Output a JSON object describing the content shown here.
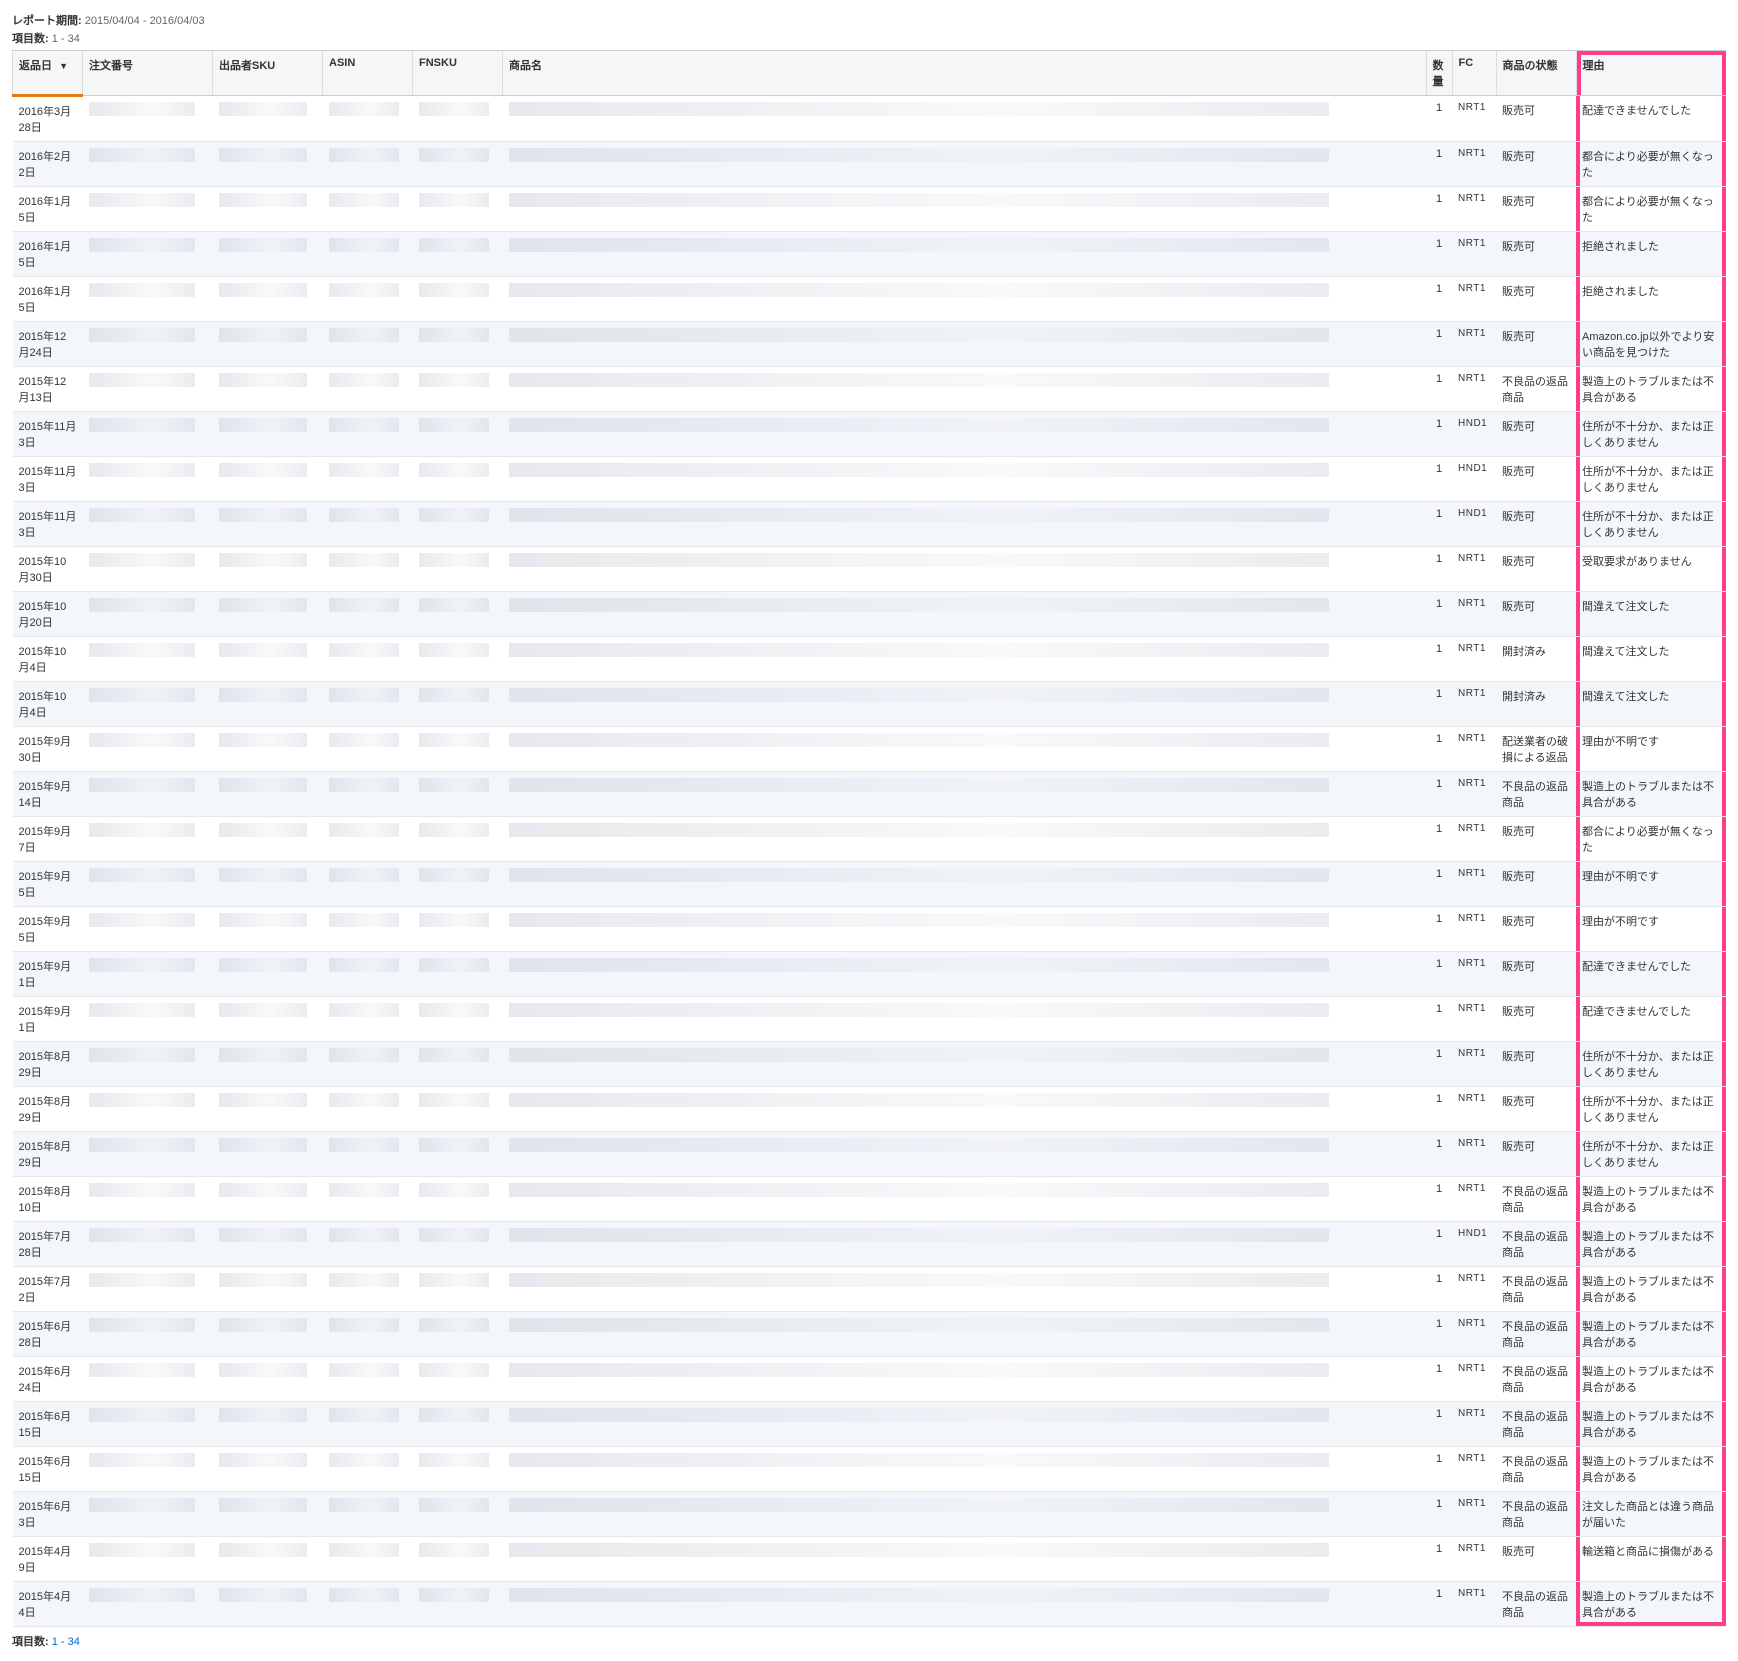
{
  "header": {
    "report_period_label": "レポート期間:",
    "report_period_value": "2015/04/04 - 2016/04/03",
    "count_label": "項目数:",
    "count_value": "1 - 34"
  },
  "columns": {
    "return_date": "返品日",
    "order_id": "注文番号",
    "seller_sku": "出品者SKU",
    "asin": "ASIN",
    "fnsku": "FNSKU",
    "product_name": "商品名",
    "quantity": "数量",
    "fc": "FC",
    "condition": "商品の状態",
    "reason": "理由"
  },
  "rows": [
    {
      "date": "2016年3月28日",
      "qty": "1",
      "fc": "NRT1",
      "cond": "販売可",
      "reason": "配達できませんでした"
    },
    {
      "date": "2016年2月2日",
      "qty": "1",
      "fc": "NRT1",
      "cond": "販売可",
      "reason": "都合により必要が無くなった"
    },
    {
      "date": "2016年1月5日",
      "qty": "1",
      "fc": "NRT1",
      "cond": "販売可",
      "reason": "都合により必要が無くなった"
    },
    {
      "date": "2016年1月5日",
      "qty": "1",
      "fc": "NRT1",
      "cond": "販売可",
      "reason": "拒絶されました"
    },
    {
      "date": "2016年1月5日",
      "qty": "1",
      "fc": "NRT1",
      "cond": "販売可",
      "reason": "拒絶されました"
    },
    {
      "date": "2015年12月24日",
      "qty": "1",
      "fc": "NRT1",
      "cond": "販売可",
      "reason": "Amazon.co.jp以外でより安い商品を見つけた"
    },
    {
      "date": "2015年12月13日",
      "qty": "1",
      "fc": "NRT1",
      "cond": "不良品の返品商品",
      "reason": "製造上のトラブルまたは不具合がある"
    },
    {
      "date": "2015年11月3日",
      "qty": "1",
      "fc": "HND1",
      "cond": "販売可",
      "reason": "住所が不十分か、または正しくありません"
    },
    {
      "date": "2015年11月3日",
      "qty": "1",
      "fc": "HND1",
      "cond": "販売可",
      "reason": "住所が不十分か、または正しくありません"
    },
    {
      "date": "2015年11月3日",
      "qty": "1",
      "fc": "HND1",
      "cond": "販売可",
      "reason": "住所が不十分か、または正しくありません"
    },
    {
      "date": "2015年10月30日",
      "qty": "1",
      "fc": "NRT1",
      "cond": "販売可",
      "reason": "受取要求がありません"
    },
    {
      "date": "2015年10月20日",
      "qty": "1",
      "fc": "NRT1",
      "cond": "販売可",
      "reason": "間違えて注文した"
    },
    {
      "date": "2015年10月4日",
      "qty": "1",
      "fc": "NRT1",
      "cond": "開封済み",
      "reason": "間違えて注文した"
    },
    {
      "date": "2015年10月4日",
      "qty": "1",
      "fc": "NRT1",
      "cond": "開封済み",
      "reason": "間違えて注文した"
    },
    {
      "date": "2015年9月30日",
      "qty": "1",
      "fc": "NRT1",
      "cond": "配送業者の破損による返品",
      "reason": "理由が不明です"
    },
    {
      "date": "2015年9月14日",
      "qty": "1",
      "fc": "NRT1",
      "cond": "不良品の返品商品",
      "reason": "製造上のトラブルまたは不具合がある"
    },
    {
      "date": "2015年9月7日",
      "qty": "1",
      "fc": "NRT1",
      "cond": "販売可",
      "reason": "都合により必要が無くなった"
    },
    {
      "date": "2015年9月5日",
      "qty": "1",
      "fc": "NRT1",
      "cond": "販売可",
      "reason": "理由が不明です"
    },
    {
      "date": "2015年9月5日",
      "qty": "1",
      "fc": "NRT1",
      "cond": "販売可",
      "reason": "理由が不明です"
    },
    {
      "date": "2015年9月1日",
      "qty": "1",
      "fc": "NRT1",
      "cond": "販売可",
      "reason": "配達できませんでした"
    },
    {
      "date": "2015年9月1日",
      "qty": "1",
      "fc": "NRT1",
      "cond": "販売可",
      "reason": "配達できませんでした"
    },
    {
      "date": "2015年8月29日",
      "qty": "1",
      "fc": "NRT1",
      "cond": "販売可",
      "reason": "住所が不十分か、または正しくありません"
    },
    {
      "date": "2015年8月29日",
      "qty": "1",
      "fc": "NRT1",
      "cond": "販売可",
      "reason": "住所が不十分か、または正しくありません"
    },
    {
      "date": "2015年8月29日",
      "qty": "1",
      "fc": "NRT1",
      "cond": "販売可",
      "reason": "住所が不十分か、または正しくありません"
    },
    {
      "date": "2015年8月10日",
      "qty": "1",
      "fc": "NRT1",
      "cond": "不良品の返品商品",
      "reason": "製造上のトラブルまたは不具合がある"
    },
    {
      "date": "2015年7月28日",
      "qty": "1",
      "fc": "HND1",
      "cond": "不良品の返品商品",
      "reason": "製造上のトラブルまたは不具合がある"
    },
    {
      "date": "2015年7月2日",
      "qty": "1",
      "fc": "NRT1",
      "cond": "不良品の返品商品",
      "reason": "製造上のトラブルまたは不具合がある"
    },
    {
      "date": "2015年6月28日",
      "qty": "1",
      "fc": "NRT1",
      "cond": "不良品の返品商品",
      "reason": "製造上のトラブルまたは不具合がある"
    },
    {
      "date": "2015年6月24日",
      "qty": "1",
      "fc": "NRT1",
      "cond": "不良品の返品商品",
      "reason": "製造上のトラブルまたは不具合がある"
    },
    {
      "date": "2015年6月15日",
      "qty": "1",
      "fc": "NRT1",
      "cond": "不良品の返品商品",
      "reason": "製造上のトラブルまたは不具合がある"
    },
    {
      "date": "2015年6月15日",
      "qty": "1",
      "fc": "NRT1",
      "cond": "不良品の返品商品",
      "reason": "製造上のトラブルまたは不具合がある"
    },
    {
      "date": "2015年6月3日",
      "qty": "1",
      "fc": "NRT1",
      "cond": "不良品の返品商品",
      "reason": "注文した商品とは違う商品が届いた"
    },
    {
      "date": "2015年4月9日",
      "qty": "1",
      "fc": "NRT1",
      "cond": "販売可",
      "reason": "輸送箱と商品に損傷がある"
    },
    {
      "date": "2015年4月4日",
      "qty": "1",
      "fc": "NRT1",
      "cond": "不良品の返品商品",
      "reason": "製造上のトラブルまたは不具合がある"
    }
  ],
  "footer": {
    "count_label": "項目数:",
    "count_value": "1 - 34"
  }
}
